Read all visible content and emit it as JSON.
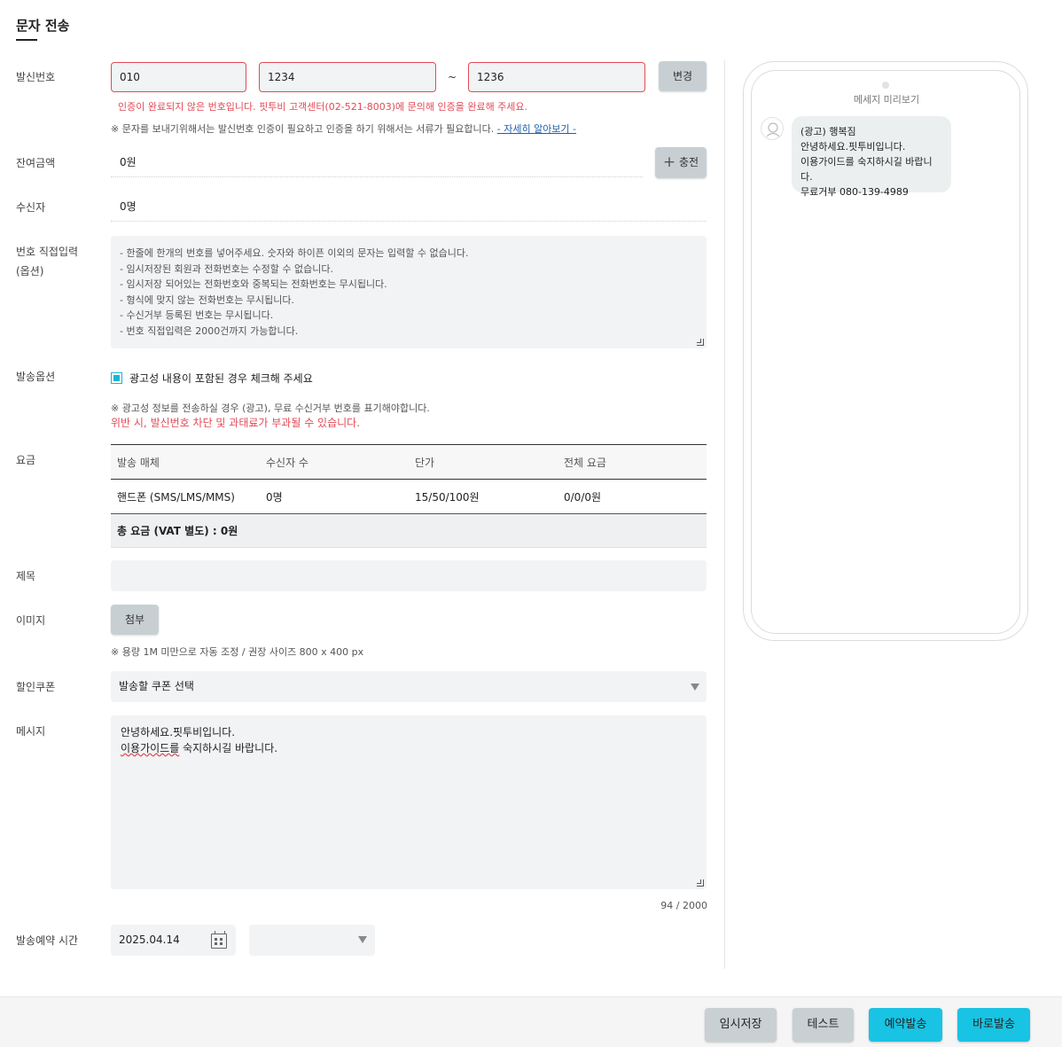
{
  "page": {
    "title": "문자 전송"
  },
  "sender": {
    "label": "발신번호",
    "part1": "010",
    "part2": "1234",
    "separator": "~",
    "part3": "1236",
    "change_button": "변경",
    "error": "인증이 완료되지 않은 번호입니다. 핏투비 고객센터(02-521-8003)에 문의해 인증을 완료해 주세요.",
    "note": "※ 문자를 보내기위해서는 발신번호 인증이 필요하고 인증을 하기 위해서는 서류가 필요합니다.",
    "learn_more": "- 자세히 알아보기 -"
  },
  "balance": {
    "label": "잔여금액",
    "value": "0원",
    "charge_button": "충전"
  },
  "recipients": {
    "label": "수신자",
    "value": "0명"
  },
  "direct_input": {
    "label_line1": "번호 직접입력",
    "label_line2": "(옵션)",
    "lines": [
      "- 한줄에 한개의 번호를 넣어주세요. 숫자와 하이픈 이외의 문자는 입력할 수 없습니다.",
      "- 임시저장된 회원과 전화번호는 수정할 수 없습니다.",
      "- 임시저장 되어있는 전화번호와 중복되는 전화번호는 무시됩니다.",
      "- 형식에 맞지 않는 전화번호는 무시됩니다.",
      "- 수신거부 등록된 번호는 무시됩니다.",
      "- 번호 직접입력은 2000건까지 가능합니다."
    ]
  },
  "send_options": {
    "label": "발송옵션",
    "checkbox_label": "광고성 내용이 포함된 경우 체크해 주세요",
    "checked": true,
    "note": "※ 광고성 정보를 전송하실 경우 (광고), 무료 수신거부 번호를 표기해야합니다.",
    "warning": "위반 시, 발신번호 차단 및 과태료가 부과될 수 있습니다."
  },
  "fee": {
    "label": "요금",
    "headers": [
      "발송 매체",
      "수신자 수",
      "단가",
      "전체 요금"
    ],
    "row": [
      "핸드폰 (SMS/LMS/MMS)",
      "0명",
      "15/50/100원",
      "0/0/0원"
    ],
    "total": "총 요금 (VAT 별도) : 0원"
  },
  "subject": {
    "label": "제목",
    "value": ""
  },
  "image": {
    "label": "이미지",
    "attach_button": "첨부",
    "note": "※ 용량 1M 미만으로 자동 조정 / 권장 사이즈 800 x 400 px"
  },
  "coupon": {
    "label": "할인쿠폰",
    "selected": "발송할 쿠폰 선택"
  },
  "message": {
    "label": "메시지",
    "line1": "안녕하세요.핏투비입니다.",
    "line2_part1": "이용가이드를",
    "line2_part2": " 숙지하시길 바랍니다.",
    "counter": "94 / 2000"
  },
  "schedule": {
    "label": "발송예약 시간",
    "date": "2025.04.14",
    "time": ""
  },
  "preview": {
    "title": "메세지 미리보기",
    "lines": [
      "(광고) 행복짐",
      "안녕하세요.핏투비입니다.",
      "이용가이드를 숙지하시길 바랍니다.",
      "무료거부 080-139-4989"
    ]
  },
  "footer": {
    "temp_save": "임시저장",
    "test": "테스트",
    "reserve_send": "예약발송",
    "send_now": "바로발송"
  },
  "colors": {
    "accent": "#19c3e3",
    "error": "#e24a56",
    "button_gray": "#c9d0d4"
  }
}
